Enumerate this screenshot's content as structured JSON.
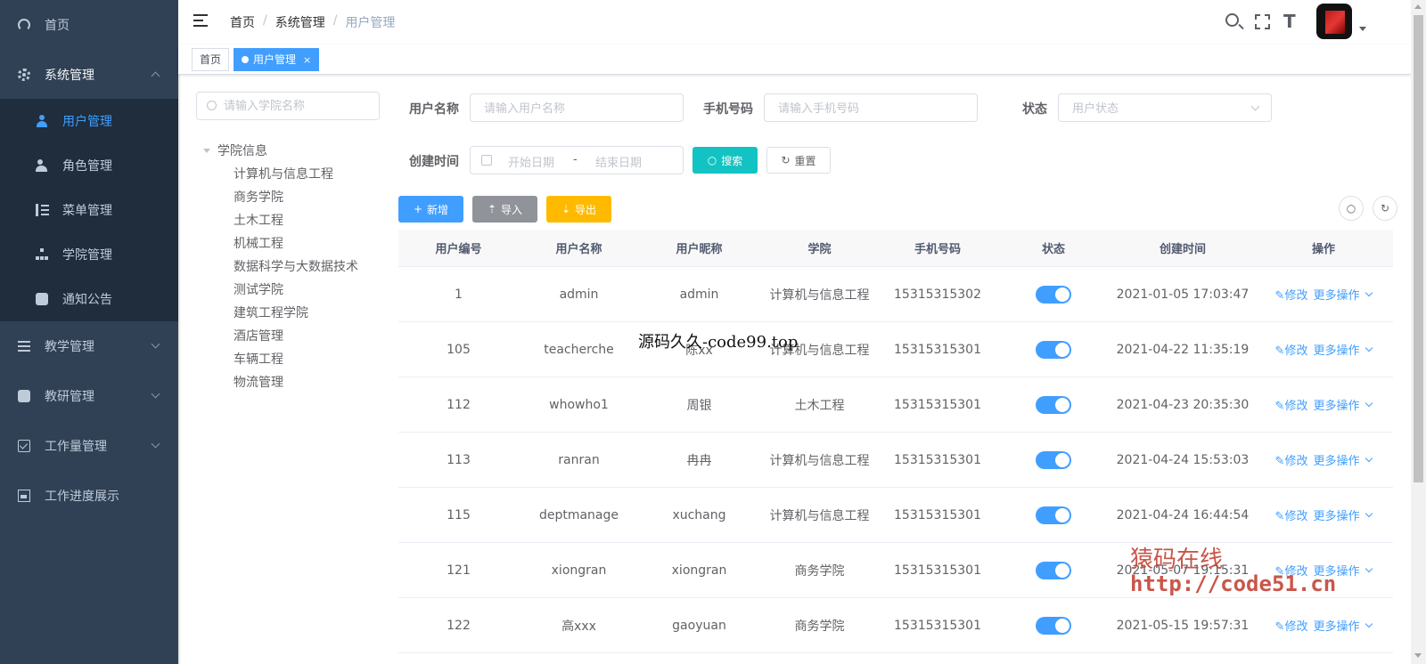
{
  "sidebar": {
    "home": "首页",
    "system": "系统管理",
    "system_children": [
      "用户管理",
      "角色管理",
      "菜单管理",
      "学院管理",
      "通知公告"
    ],
    "teaching": "教学管理",
    "research": "教研管理",
    "workload": "工作量管理",
    "progress": "工作进度展示"
  },
  "navbar": {
    "breadcrumb": [
      "首页",
      "系统管理",
      "用户管理"
    ],
    "sep": "/"
  },
  "tags": {
    "home": "首页",
    "active": "用户管理",
    "close": "×"
  },
  "tree": {
    "search_placeholder": "请输入学院名称",
    "root": "学院信息",
    "nodes": [
      "计算机与信息工程",
      "商务学院",
      "土木工程",
      "机械工程",
      "数据科学与大数据技术",
      "测试学院",
      "建筑工程学院",
      "酒店管理",
      "车辆工程",
      "物流管理"
    ]
  },
  "form": {
    "username_label": "用户名称",
    "username_placeholder": "请输入用户名称",
    "phone_label": "手机号码",
    "phone_placeholder": "请输入手机号码",
    "status_label": "状态",
    "status_placeholder": "用户状态",
    "created_label": "创建时间",
    "start_placeholder": "开始日期",
    "range_sep": "-",
    "end_placeholder": "结束日期",
    "search_btn": "搜索",
    "reset_btn": "重置"
  },
  "toolbar": {
    "add": "新增",
    "import": "导入",
    "export": "导出"
  },
  "table": {
    "headers": [
      "用户编号",
      "用户名称",
      "用户昵称",
      "学院",
      "手机号码",
      "状态",
      "创建时间",
      "操作"
    ],
    "edit_label": "修改",
    "more_label": "更多操作",
    "rows": [
      {
        "id": "1",
        "username": "admin",
        "nickname": "admin",
        "college": "计算机与信息工程",
        "phone": "15315315302",
        "status": true,
        "created": "2021-01-05 17:03:47"
      },
      {
        "id": "105",
        "username": "teacherche",
        "nickname": "陈xx",
        "college": "计算机与信息工程",
        "phone": "15315315301",
        "status": true,
        "created": "2021-04-22 11:35:19"
      },
      {
        "id": "112",
        "username": "whowho1",
        "nickname": "周银",
        "college": "土木工程",
        "phone": "15315315301",
        "status": true,
        "created": "2021-04-23 20:35:30"
      },
      {
        "id": "113",
        "username": "ranran",
        "nickname": "冉冉",
        "college": "计算机与信息工程",
        "phone": "15315315301",
        "status": true,
        "created": "2021-04-24 15:53:03"
      },
      {
        "id": "115",
        "username": "deptmanage",
        "nickname": "xuchang",
        "college": "计算机与信息工程",
        "phone": "15315315301",
        "status": true,
        "created": "2021-04-24 16:44:54"
      },
      {
        "id": "121",
        "username": "xiongran",
        "nickname": "xiongran",
        "college": "商务学院",
        "phone": "15315315301",
        "status": true,
        "created": "2021-05-07 19:15:31"
      },
      {
        "id": "122",
        "username": "高xxx",
        "nickname": "gaoyuan",
        "college": "商务学院",
        "phone": "15315315301",
        "status": true,
        "created": "2021-05-15 19:57:31"
      }
    ]
  },
  "watermarks": {
    "top": "源码久久-code99.top",
    "cn": "猿码在线",
    "url": "http://code51.cn"
  },
  "colors": {
    "sidebar_bg": "#304156",
    "submenu_bg": "#1f2d3d",
    "primary": "#409eff",
    "cyan": "#13c2c2",
    "info": "#909399",
    "warning": "#ffba00"
  }
}
